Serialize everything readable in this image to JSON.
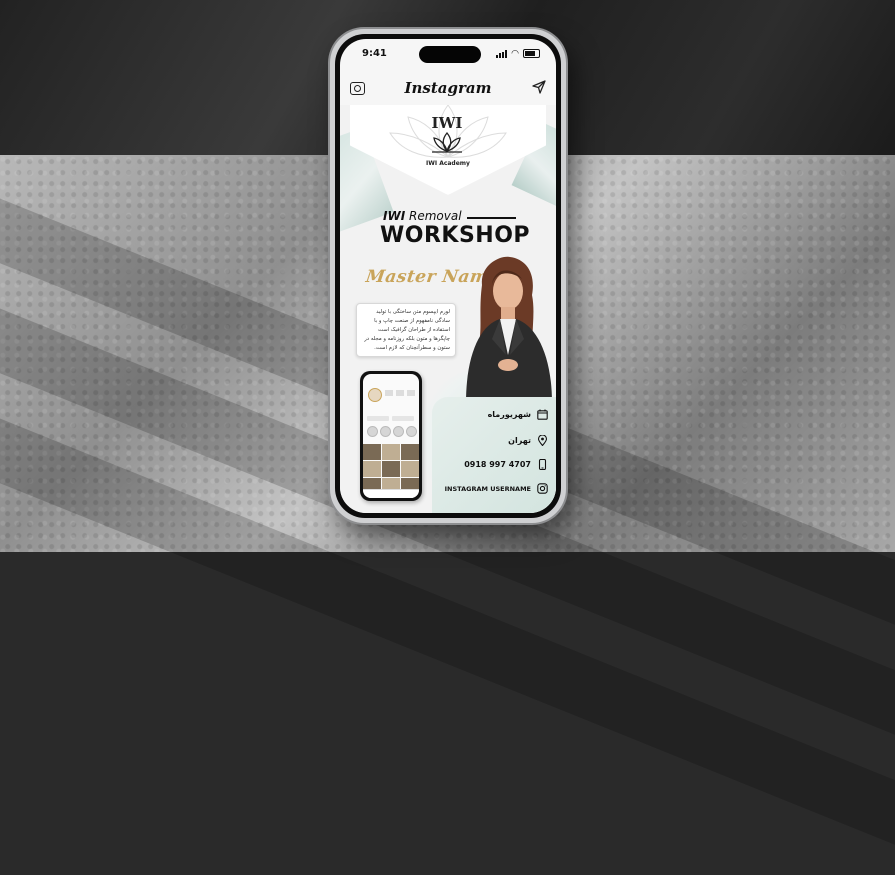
{
  "status_bar": {
    "time": "9:41"
  },
  "app": {
    "name": "Instagram"
  },
  "post": {
    "brand": "IWI Academy",
    "subtitle_bold": "IWI",
    "subtitle_rest": "Removal",
    "title": "WORKSHOP",
    "master_name": "Master Name",
    "description": "لورم ایپسوم متن ساختگی با تولید سادگی نامفهوم از صنعت چاپ و با استفاده از طراحان گرافیک است چاپگرها و متون بلکه روزنامه و مجله در ستون و سطرآنچنان که لازم است.",
    "info": [
      {
        "icon": "calendar-icon",
        "text": "شهریورماه"
      },
      {
        "icon": "location-pin-icon",
        "text": "تهران"
      },
      {
        "icon": "phone-icon",
        "text": "0918 997 4707"
      },
      {
        "icon": "instagram-icon",
        "text": "INSTAGRAM USERNAME"
      }
    ]
  },
  "colors": {
    "gold": "#c9a45a",
    "mint": "#d3e4df",
    "text": "#111111"
  }
}
